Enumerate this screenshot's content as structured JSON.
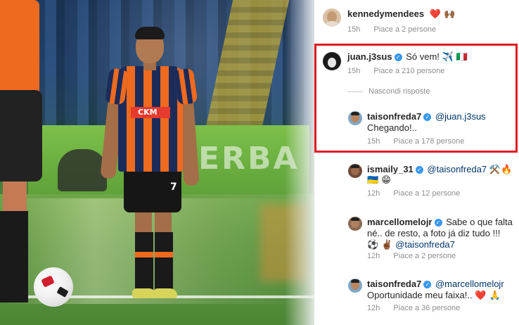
{
  "comments": [
    {
      "username": "kennedymendees",
      "verified": false,
      "text": "",
      "emoji": "❤️ 🙌🏾",
      "time": "15h",
      "likes": "Piace a 2 persone"
    },
    {
      "username": "juan.j3sus",
      "verified": true,
      "text": "Só vem!",
      "emoji": "✈️ 🇮🇹",
      "time": "15h",
      "likes": "Piace a 210 persone",
      "hide_replies": "Nascondi risposte",
      "reply": {
        "username": "taisonfreda7",
        "verified": true,
        "mention": "@juan.j3sus",
        "text": "Chegando!..",
        "time": "15h",
        "likes": "Piace a 178 persone"
      }
    },
    {
      "username": "ismaily_31",
      "verified": true,
      "mention": "@taisonfreda7",
      "emoji": "⚒️🔥",
      "emoji_line2": "🇺🇦 😁",
      "time": "12h",
      "likes": "Piace a 12 persone"
    },
    {
      "username": "marcellomelojr",
      "verified": true,
      "text": "Sabe o que falta",
      "text_line2": "né.. de resto, a foto já diz tudo !!!",
      "emoji_line3": "⚽️ ✌🏾",
      "mention": "@taisonfreda7",
      "time": "12h",
      "likes": "Piace a 2 persone"
    },
    {
      "username": "taisonfreda7",
      "verified": true,
      "mention": "@marcellomelojr",
      "text": "Oportunidade meu faixa!..",
      "emoji": "❤️ 🙏",
      "time": "12h",
      "likes": "Piace a 36 persone"
    }
  ],
  "photo": {
    "ad_board_text": "ERBA",
    "sponsor_text": "CKM",
    "shirt_number": "7"
  },
  "colors": {
    "highlight": "#e01b24",
    "verified": "#3897f0",
    "meta": "#8e8e8e",
    "mention": "#00376b",
    "shirt_orange": "#ee6a1e",
    "shirt_navy": "#1c2c5a"
  }
}
